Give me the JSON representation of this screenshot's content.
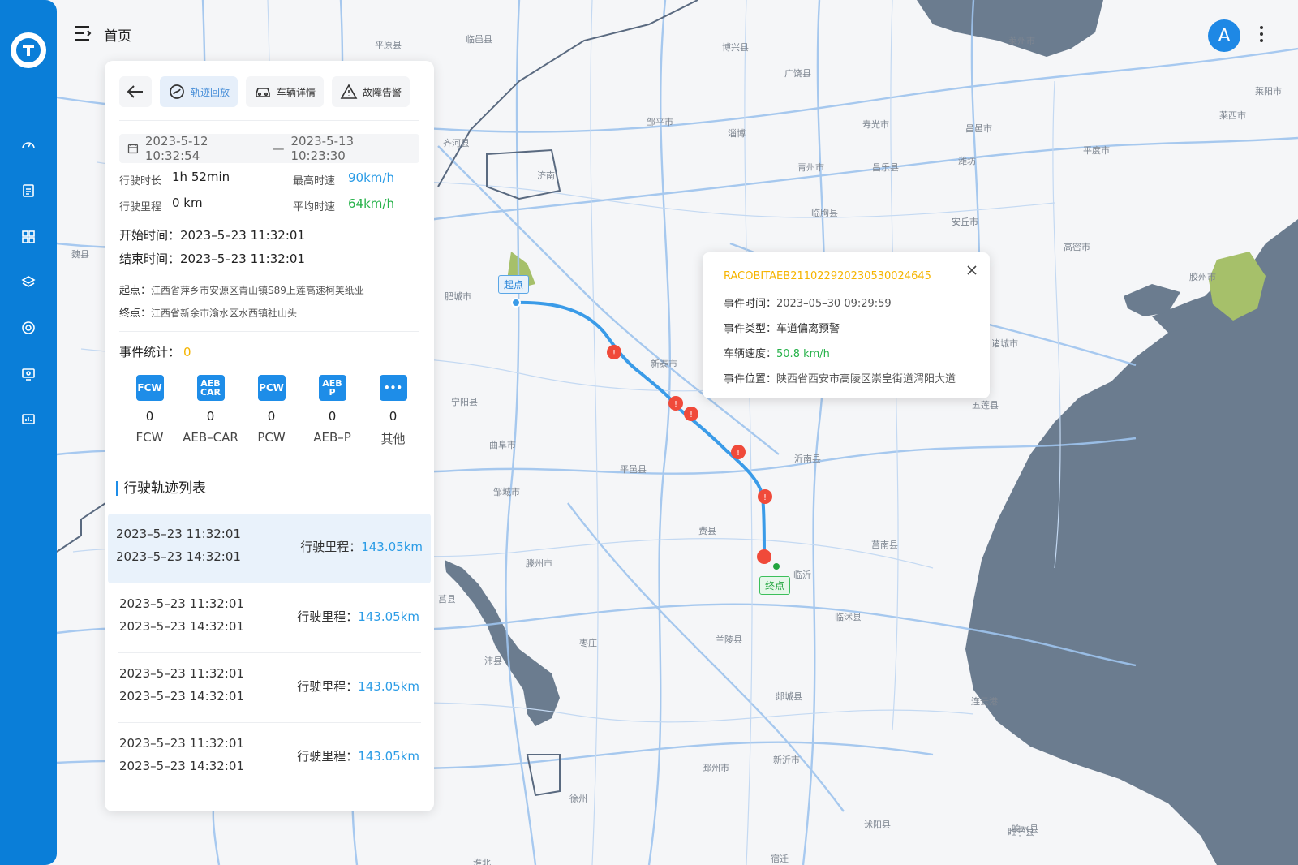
{
  "header": {
    "title": "首页",
    "avatar_letter": "A"
  },
  "toolbar": {
    "back_label": "",
    "tabs": [
      {
        "label": "轨迹回放",
        "active": true
      },
      {
        "label": "车辆详情",
        "active": false
      },
      {
        "label": "故障告警",
        "active": false
      }
    ]
  },
  "trip_summary": {
    "date_from": "2023-5-12 10:32:54",
    "date_separator": "—",
    "date_to": "2023-5-13 10:23:30",
    "duration_label": "行驶时长",
    "duration_value": "1h 52min",
    "max_speed_label": "最高时速",
    "max_speed_value": "90km/h",
    "distance_label": "行驶里程",
    "distance_value": "0 km",
    "avg_speed_label": "平均时速",
    "avg_speed_value": "64km/h",
    "start_time_label": "开始时间：",
    "start_time_value": "2023–5–23 11:32:01",
    "end_time_label": "结束时间：",
    "end_time_value": "2023–5–23 11:32:01",
    "origin_label": "起点：",
    "origin_value": "江西省萍乡市安源区青山镇S89上莲高速柯美纸业",
    "destination_label": "终点：",
    "destination_value": "江西省新余市渝水区水西镇社山头"
  },
  "events": {
    "label": "事件统计：",
    "total": "0",
    "items": [
      {
        "icon_text": "FCW",
        "count": "0",
        "name": "FCW"
      },
      {
        "icon_text": "AEB CAR",
        "count": "0",
        "name": "AEB–CAR"
      },
      {
        "icon_text": "PCW",
        "count": "0",
        "name": "PCW"
      },
      {
        "icon_text": "AEB P",
        "count": "0",
        "name": "AEB–P"
      },
      {
        "icon_text": "•••",
        "count": "0",
        "name": "其他"
      }
    ]
  },
  "trip_list": {
    "title": "行驶轨迹列表",
    "distance_label": "行驶里程：",
    "items": [
      {
        "start": "2023–5–23 11:32:01",
        "end": "2023–5–23 14:32:01",
        "distance": "143.05km",
        "selected": true
      },
      {
        "start": "2023–5–23 11:32:01",
        "end": "2023–5–23 14:32:01",
        "distance": "143.05km",
        "selected": false
      },
      {
        "start": "2023–5–23 11:32:01",
        "end": "2023–5–23 14:32:01",
        "distance": "143.05km",
        "selected": false
      },
      {
        "start": "2023–5–23 11:32:01",
        "end": "2023–5–23 14:32:01",
        "distance": "143.05km",
        "selected": false
      }
    ]
  },
  "popup": {
    "event_id": "RACOBITAEB211022920230530024645",
    "time_label": "事件时间：",
    "time_value": "2023–05–30 09:29:59",
    "type_label": "事件类型：",
    "type_value": "车道偏离预警",
    "speed_label": "车辆速度：",
    "speed_value": "50.8 km/h",
    "location_label": "事件位置：",
    "location_value": "陕西省西安市高陵区崇皇街道渭阳大道"
  },
  "map": {
    "start_label": "起点",
    "end_label": "终点",
    "cities": [
      "平原县",
      "临邑县",
      "博兴县",
      "广饶县",
      "莱州市",
      "莱阳市",
      "莱西市",
      "邹平市",
      "淄博",
      "寿光市",
      "昌邑市",
      "平度市",
      "齐河县",
      "济南",
      "青州市",
      "昌乐县",
      "潍坊",
      "临朐县",
      "安丘市",
      "高密市",
      "胶州市",
      "肥城市",
      "新泰市",
      "诸城市",
      "宁阳县",
      "沂南县",
      "五莲县",
      "曲阜市",
      "平邑县",
      "邹城市",
      "费县",
      "莒南县",
      "滕州市",
      "临沂",
      "临沭县",
      "枣庄",
      "兰陵县",
      "沛县",
      "郯城县",
      "连云港",
      "邳州市",
      "新沂市",
      "徐州",
      "沭阳县",
      "睢宁县",
      "宿迁",
      "淮北",
      "魏县",
      "响水县",
      "莒县"
    ],
    "colors": {
      "land": "#f5f6f8",
      "water": "#6b7c8f",
      "road": "#9ec4ee",
      "route": "#3a9be8",
      "alert": "#f04a3a",
      "park": "#a6c06a"
    }
  }
}
